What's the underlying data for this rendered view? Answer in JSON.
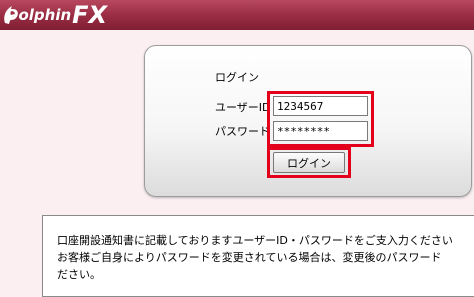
{
  "header": {
    "logo_text": "Dolphin",
    "logo_fx": "FX",
    "bar_color": "#9a2e44"
  },
  "login": {
    "title": "ログイン",
    "user_label": "ユーザーID",
    "user_value": "1234567",
    "password_label": "パスワード",
    "password_value": "********",
    "submit_label": "ログイン",
    "highlight_color": "#e3001b"
  },
  "notice": {
    "text": "口座開設通知書に記載しておりますユーザーID・パスワードをご支入力ください\nお客様ご自身によりパスワードを変更されている場合は、変更後のパスワード\nださい。"
  }
}
